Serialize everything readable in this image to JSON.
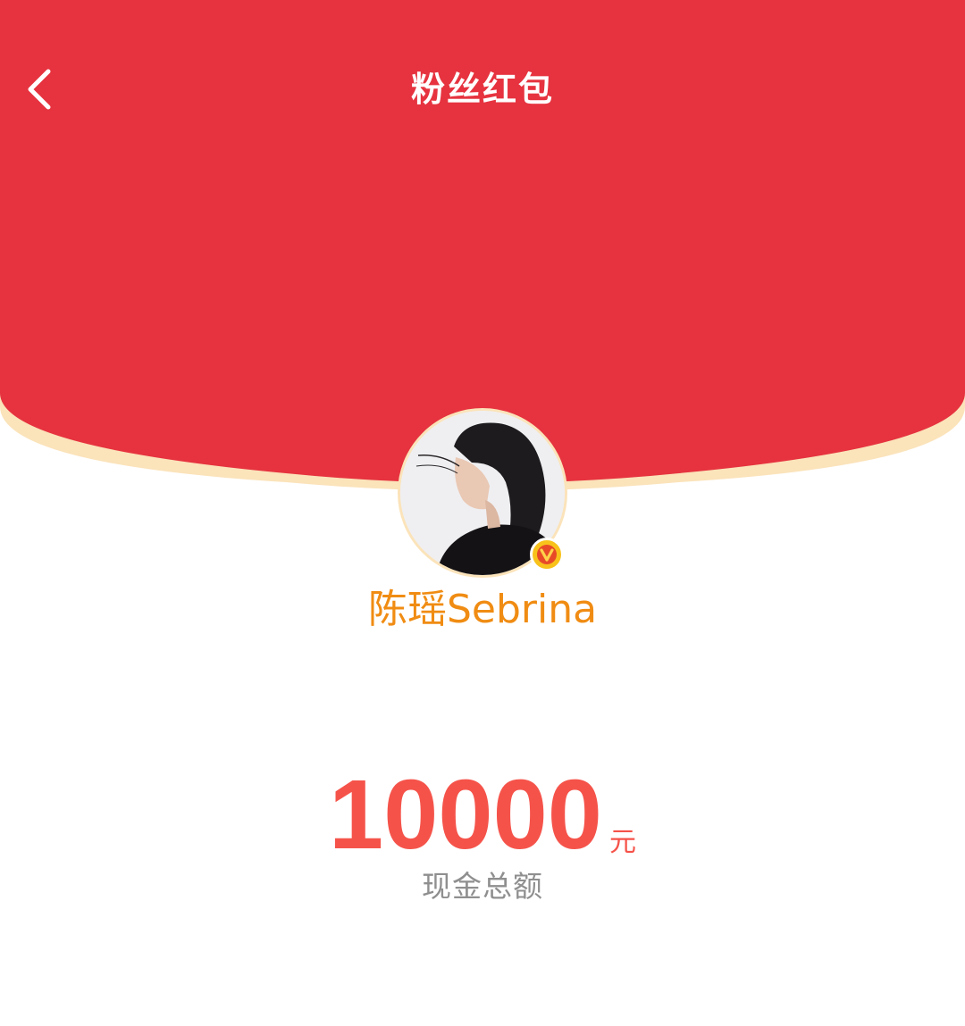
{
  "header": {
    "title": "粉丝红包",
    "back_icon": "chevron-left-icon"
  },
  "profile": {
    "username": "陈瑶Sebrina",
    "verified_badge_letter": "V",
    "avatar_icon": "user-avatar-photo"
  },
  "summary": {
    "amount": "10000",
    "unit": "元",
    "caption": "现金总额"
  },
  "colors": {
    "header_red": "#e6333f",
    "cream_rim": "#fbe3ba",
    "username_orange": "#f08c13",
    "amount_red": "#f5534a",
    "caption_gray": "#8f8f8f",
    "badge_yellow": "#f8c21b"
  }
}
